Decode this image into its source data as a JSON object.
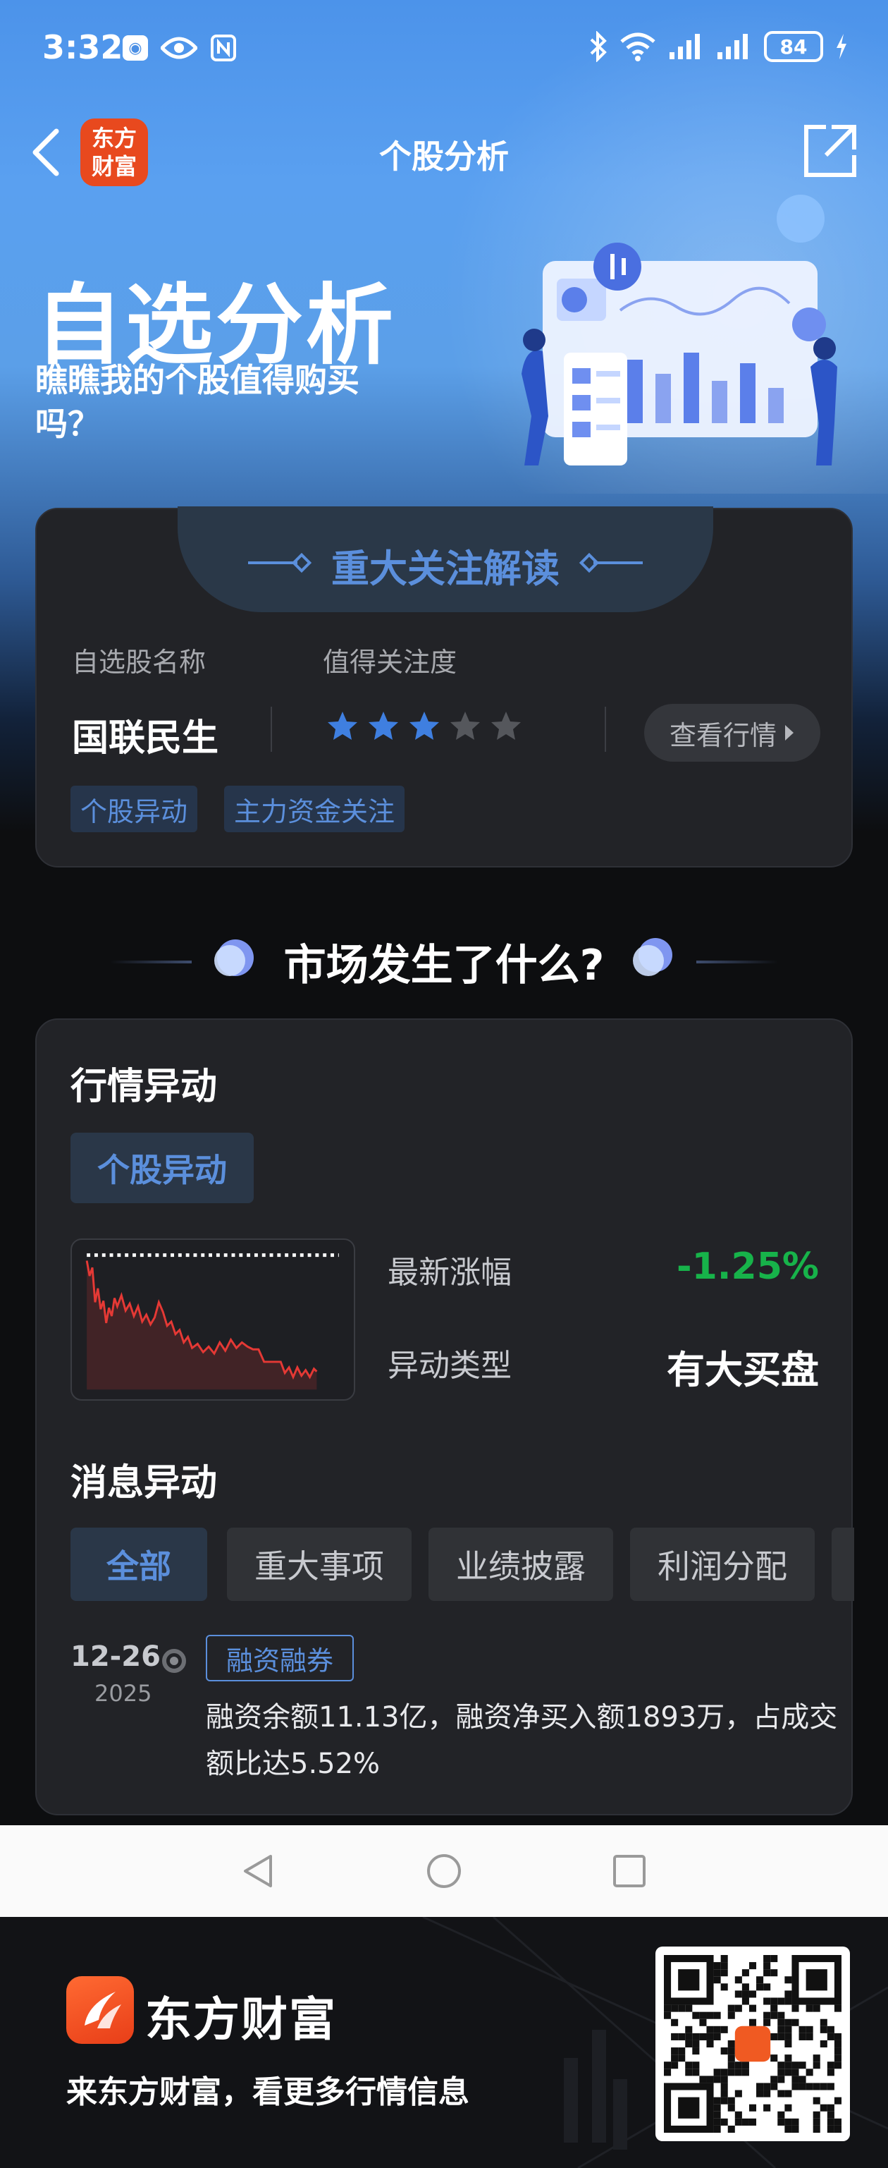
{
  "status_bar": {
    "time": "3:32",
    "battery": "84",
    "icons": [
      "app-badge-icon",
      "eye-icon",
      "nfc-icon",
      "bluetooth-icon",
      "wifi-icon",
      "signal-icon",
      "signal-icon",
      "battery-icon",
      "charging-icon"
    ]
  },
  "nav": {
    "logo_text_line1": "东方",
    "logo_text_line2": "财富",
    "title": "个股分析",
    "back_icon": "chevron-left-icon",
    "share_icon": "share-icon"
  },
  "hero": {
    "title": "自选分析",
    "subtitle": "瞧瞧我的个股值得购买吗？"
  },
  "focus_card": {
    "title": "重大关注解读",
    "stock_label": "自选股名称",
    "attention_label": "值得关注度",
    "stock_name": "国联民生",
    "attention_rating": 3,
    "attention_max": 5,
    "view_button": "查看行情",
    "tags": [
      "个股异动",
      "主力资金关注"
    ]
  },
  "market": {
    "title": "市场发生了什么?"
  },
  "quote_section": {
    "title": "行情异动",
    "tab": "个股异动",
    "change_label": "最新涨幅",
    "change_value": "-1.25%",
    "type_label": "异动类型",
    "type_value": "有大买盘",
    "colors": {
      "down": "#17b34a",
      "line": "#e53935",
      "accent": "#5b8fdc"
    }
  },
  "news_section": {
    "title": "消息异动",
    "filters": [
      "全部",
      "重大事项",
      "业绩披露",
      "利润分配"
    ],
    "active_filter": 0,
    "items": [
      {
        "date": "12-26",
        "year": "2025",
        "tag": "融资融券",
        "text": "融资余额11.13亿，融资净买入额1893万，占成交额比达5.52%"
      }
    ]
  },
  "footer": {
    "brand": "东方财富",
    "slogan": "来东方财富，看更多行情信息"
  }
}
